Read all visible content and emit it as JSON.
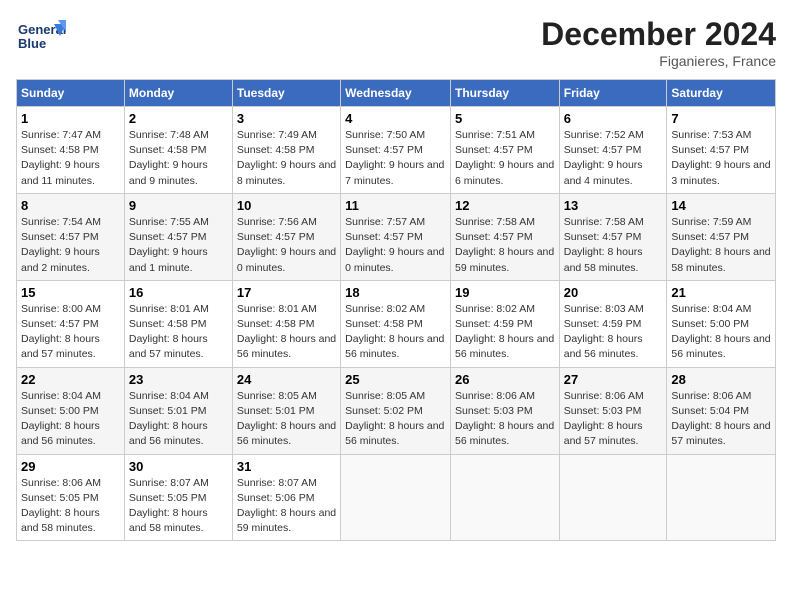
{
  "header": {
    "logo_line1": "General",
    "logo_line2": "Blue",
    "month": "December 2024",
    "location": "Figanieres, France"
  },
  "weekdays": [
    "Sunday",
    "Monday",
    "Tuesday",
    "Wednesday",
    "Thursday",
    "Friday",
    "Saturday"
  ],
  "weeks": [
    [
      {
        "day": "1",
        "sunrise": "Sunrise: 7:47 AM",
        "sunset": "Sunset: 4:58 PM",
        "daylight": "Daylight: 9 hours and 11 minutes."
      },
      {
        "day": "2",
        "sunrise": "Sunrise: 7:48 AM",
        "sunset": "Sunset: 4:58 PM",
        "daylight": "Daylight: 9 hours and 9 minutes."
      },
      {
        "day": "3",
        "sunrise": "Sunrise: 7:49 AM",
        "sunset": "Sunset: 4:58 PM",
        "daylight": "Daylight: 9 hours and 8 minutes."
      },
      {
        "day": "4",
        "sunrise": "Sunrise: 7:50 AM",
        "sunset": "Sunset: 4:57 PM",
        "daylight": "Daylight: 9 hours and 7 minutes."
      },
      {
        "day": "5",
        "sunrise": "Sunrise: 7:51 AM",
        "sunset": "Sunset: 4:57 PM",
        "daylight": "Daylight: 9 hours and 6 minutes."
      },
      {
        "day": "6",
        "sunrise": "Sunrise: 7:52 AM",
        "sunset": "Sunset: 4:57 PM",
        "daylight": "Daylight: 9 hours and 4 minutes."
      },
      {
        "day": "7",
        "sunrise": "Sunrise: 7:53 AM",
        "sunset": "Sunset: 4:57 PM",
        "daylight": "Daylight: 9 hours and 3 minutes."
      }
    ],
    [
      {
        "day": "8",
        "sunrise": "Sunrise: 7:54 AM",
        "sunset": "Sunset: 4:57 PM",
        "daylight": "Daylight: 9 hours and 2 minutes."
      },
      {
        "day": "9",
        "sunrise": "Sunrise: 7:55 AM",
        "sunset": "Sunset: 4:57 PM",
        "daylight": "Daylight: 9 hours and 1 minute."
      },
      {
        "day": "10",
        "sunrise": "Sunrise: 7:56 AM",
        "sunset": "Sunset: 4:57 PM",
        "daylight": "Daylight: 9 hours and 0 minutes."
      },
      {
        "day": "11",
        "sunrise": "Sunrise: 7:57 AM",
        "sunset": "Sunset: 4:57 PM",
        "daylight": "Daylight: 9 hours and 0 minutes."
      },
      {
        "day": "12",
        "sunrise": "Sunrise: 7:58 AM",
        "sunset": "Sunset: 4:57 PM",
        "daylight": "Daylight: 8 hours and 59 minutes."
      },
      {
        "day": "13",
        "sunrise": "Sunrise: 7:58 AM",
        "sunset": "Sunset: 4:57 PM",
        "daylight": "Daylight: 8 hours and 58 minutes."
      },
      {
        "day": "14",
        "sunrise": "Sunrise: 7:59 AM",
        "sunset": "Sunset: 4:57 PM",
        "daylight": "Daylight: 8 hours and 58 minutes."
      }
    ],
    [
      {
        "day": "15",
        "sunrise": "Sunrise: 8:00 AM",
        "sunset": "Sunset: 4:57 PM",
        "daylight": "Daylight: 8 hours and 57 minutes."
      },
      {
        "day": "16",
        "sunrise": "Sunrise: 8:01 AM",
        "sunset": "Sunset: 4:58 PM",
        "daylight": "Daylight: 8 hours and 57 minutes."
      },
      {
        "day": "17",
        "sunrise": "Sunrise: 8:01 AM",
        "sunset": "Sunset: 4:58 PM",
        "daylight": "Daylight: 8 hours and 56 minutes."
      },
      {
        "day": "18",
        "sunrise": "Sunrise: 8:02 AM",
        "sunset": "Sunset: 4:58 PM",
        "daylight": "Daylight: 8 hours and 56 minutes."
      },
      {
        "day": "19",
        "sunrise": "Sunrise: 8:02 AM",
        "sunset": "Sunset: 4:59 PM",
        "daylight": "Daylight: 8 hours and 56 minutes."
      },
      {
        "day": "20",
        "sunrise": "Sunrise: 8:03 AM",
        "sunset": "Sunset: 4:59 PM",
        "daylight": "Daylight: 8 hours and 56 minutes."
      },
      {
        "day": "21",
        "sunrise": "Sunrise: 8:04 AM",
        "sunset": "Sunset: 5:00 PM",
        "daylight": "Daylight: 8 hours and 56 minutes."
      }
    ],
    [
      {
        "day": "22",
        "sunrise": "Sunrise: 8:04 AM",
        "sunset": "Sunset: 5:00 PM",
        "daylight": "Daylight: 8 hours and 56 minutes."
      },
      {
        "day": "23",
        "sunrise": "Sunrise: 8:04 AM",
        "sunset": "Sunset: 5:01 PM",
        "daylight": "Daylight: 8 hours and 56 minutes."
      },
      {
        "day": "24",
        "sunrise": "Sunrise: 8:05 AM",
        "sunset": "Sunset: 5:01 PM",
        "daylight": "Daylight: 8 hours and 56 minutes."
      },
      {
        "day": "25",
        "sunrise": "Sunrise: 8:05 AM",
        "sunset": "Sunset: 5:02 PM",
        "daylight": "Daylight: 8 hours and 56 minutes."
      },
      {
        "day": "26",
        "sunrise": "Sunrise: 8:06 AM",
        "sunset": "Sunset: 5:03 PM",
        "daylight": "Daylight: 8 hours and 56 minutes."
      },
      {
        "day": "27",
        "sunrise": "Sunrise: 8:06 AM",
        "sunset": "Sunset: 5:03 PM",
        "daylight": "Daylight: 8 hours and 57 minutes."
      },
      {
        "day": "28",
        "sunrise": "Sunrise: 8:06 AM",
        "sunset": "Sunset: 5:04 PM",
        "daylight": "Daylight: 8 hours and 57 minutes."
      }
    ],
    [
      {
        "day": "29",
        "sunrise": "Sunrise: 8:06 AM",
        "sunset": "Sunset: 5:05 PM",
        "daylight": "Daylight: 8 hours and 58 minutes."
      },
      {
        "day": "30",
        "sunrise": "Sunrise: 8:07 AM",
        "sunset": "Sunset: 5:05 PM",
        "daylight": "Daylight: 8 hours and 58 minutes."
      },
      {
        "day": "31",
        "sunrise": "Sunrise: 8:07 AM",
        "sunset": "Sunset: 5:06 PM",
        "daylight": "Daylight: 8 hours and 59 minutes."
      },
      null,
      null,
      null,
      null
    ]
  ]
}
